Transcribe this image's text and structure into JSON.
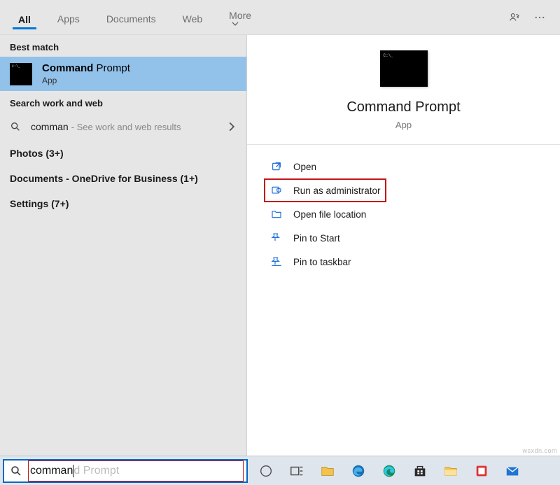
{
  "tabs": {
    "all": "All",
    "apps": "Apps",
    "documents": "Documents",
    "web": "Web",
    "more": "More"
  },
  "groups": {
    "best_match": "Best match",
    "search_work_web": "Search work and web"
  },
  "result": {
    "title_bold": "Command",
    "title_rest": " Prompt",
    "subtitle": "App"
  },
  "web_suggestion": {
    "term": "comman",
    "hint": " - See work and web results"
  },
  "categories": {
    "photos": "Photos (3+)",
    "documents": "Documents - OneDrive for Business (1+)",
    "settings": "Settings (7+)"
  },
  "preview": {
    "title": "Command Prompt",
    "subtitle": "App"
  },
  "actions": {
    "open": "Open",
    "run_admin": "Run as administrator",
    "open_location": "Open file location",
    "pin_start": "Pin to Start",
    "pin_taskbar": "Pin to taskbar"
  },
  "search": {
    "typed": "comman",
    "ghost": "d Prompt"
  },
  "watermark": "wsxdn.com"
}
